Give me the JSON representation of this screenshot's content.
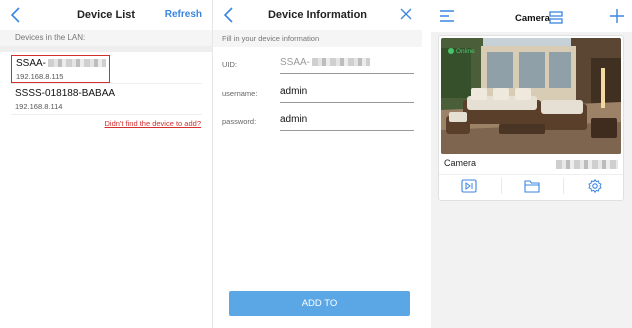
{
  "colors": {
    "accent": "#3a86e0",
    "warning": "#d32f2f",
    "online": "#48c46b",
    "button": "#5ba7e6"
  },
  "device_list": {
    "title": "Device List",
    "refresh_label": "Refresh",
    "section_label": "Devices in the LAN:",
    "devices": [
      {
        "name": "SSAA-",
        "ip": "192.168.8.115",
        "selected": true
      },
      {
        "name": "SSSS-018188-BABAA",
        "ip": "192.168.8.114",
        "selected": false
      }
    ],
    "not_found_link": "Didn't find the device to add?"
  },
  "device_info": {
    "title": "Device Information",
    "fill_label": "Fill in your device information",
    "fields": {
      "uid": {
        "label": "UID:",
        "value": "SSAA-"
      },
      "username": {
        "label": "username:",
        "value": "admin"
      },
      "password": {
        "label": "password:",
        "value": "admin"
      }
    },
    "add_button": "ADD TO"
  },
  "camera_list": {
    "title": "Camera",
    "camera": {
      "name": "Camera",
      "status": "Online"
    },
    "icons": [
      "menu-icon",
      "camera-switch-icon",
      "plus-icon",
      "playback-icon",
      "folder-icon",
      "settings-icon"
    ]
  }
}
